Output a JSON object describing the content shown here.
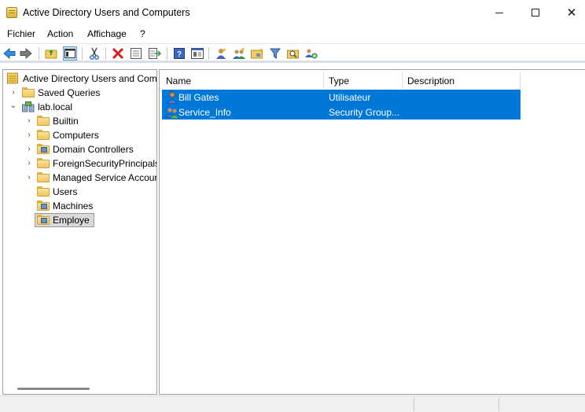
{
  "window": {
    "title": "Active Directory Users and Computers"
  },
  "menu": {
    "items": [
      "Fichier",
      "Action",
      "Affichage",
      "?"
    ]
  },
  "toolbar": {
    "icons": [
      "back-arrow-icon",
      "forward-arrow-icon",
      "up-folder-icon",
      "console-tree-icon",
      "cut-icon",
      "delete-icon",
      "properties-icon",
      "export-list-icon",
      "help-icon",
      "mmc-view-icon",
      "new-user-icon",
      "new-group-icon",
      "new-ou-icon",
      "filter-icon",
      "find-icon",
      "add-to-group-icon"
    ]
  },
  "tree": {
    "root": "Active Directory Users and Com",
    "items": [
      {
        "label": "Saved Queries",
        "expander": "›"
      },
      {
        "label": "lab.local",
        "expander": "⌄"
      },
      {
        "label": "Builtin",
        "expander": "›"
      },
      {
        "label": "Computers",
        "expander": "›"
      },
      {
        "label": "Domain Controllers",
        "expander": "›"
      },
      {
        "label": "ForeignSecurityPrincipals",
        "expander": "›"
      },
      {
        "label": "Managed Service Accour",
        "expander": "›"
      },
      {
        "label": "Users",
        "expander": ""
      },
      {
        "label": "Machines",
        "expander": ""
      },
      {
        "label": "Employe",
        "expander": ""
      }
    ]
  },
  "list": {
    "columns": [
      "Name",
      "Type",
      "Description"
    ],
    "rows": [
      {
        "name": "Bill Gates",
        "type": "Utilisateur",
        "description": ""
      },
      {
        "name": "Service_Info",
        "type": "Security Group...",
        "description": ""
      }
    ]
  },
  "colors": {
    "selection": "#0078d7",
    "folder": "#efc65c"
  }
}
